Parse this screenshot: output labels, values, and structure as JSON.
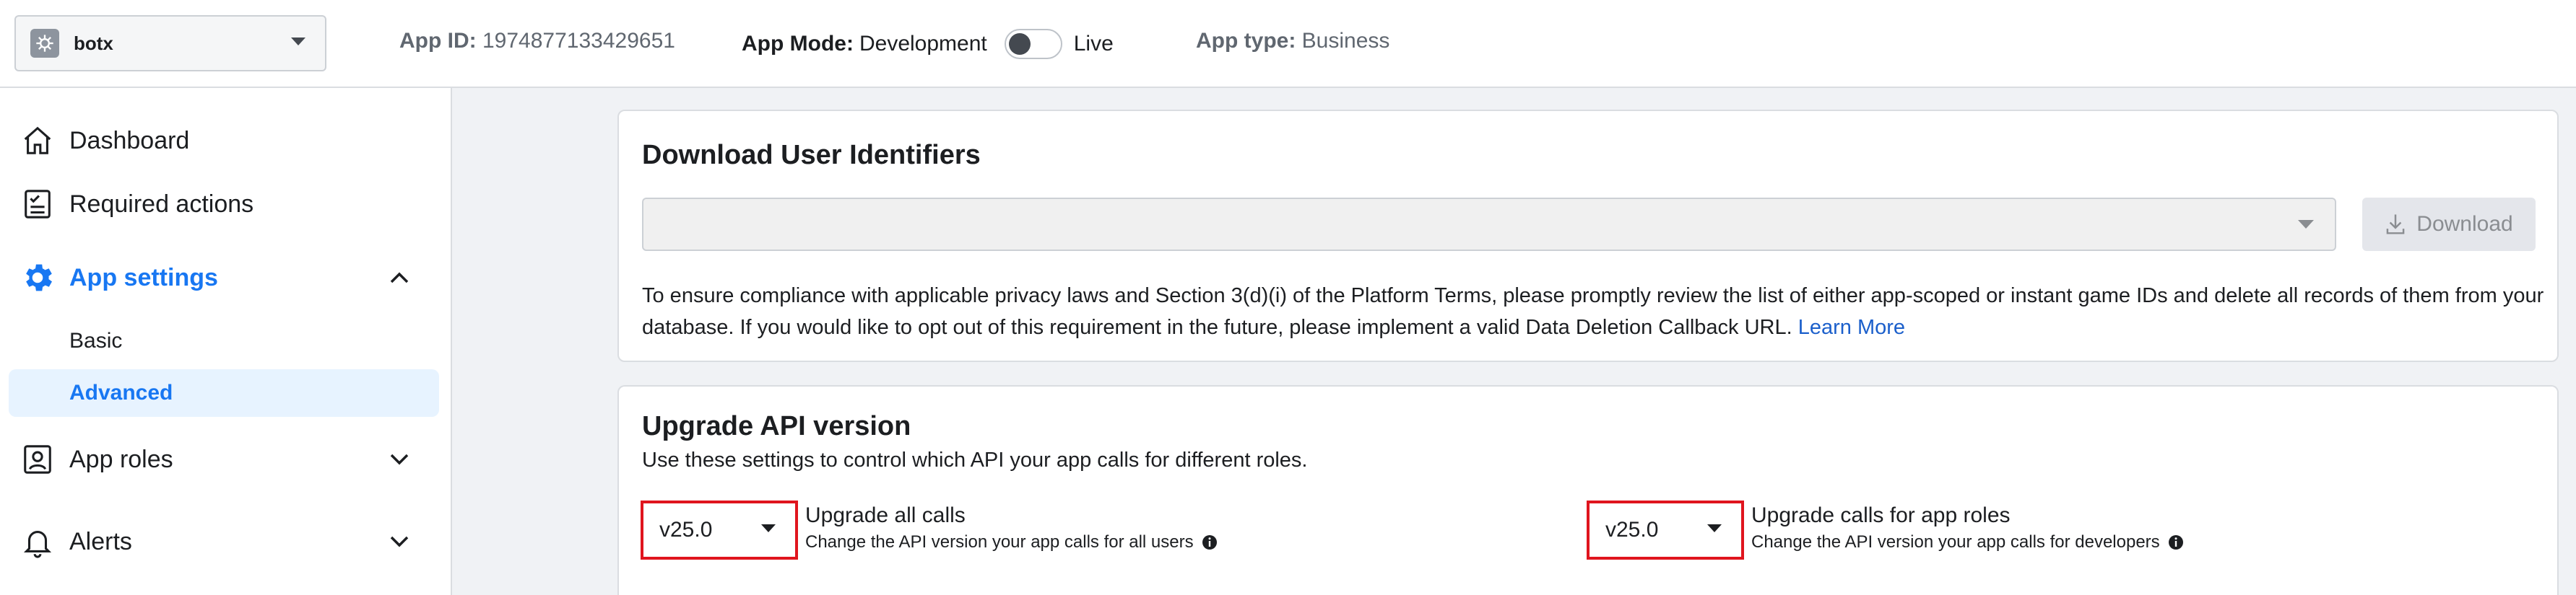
{
  "topbar": {
    "app_name": "botx",
    "app_id_label": "App ID:",
    "app_id_value": "1974877133429651",
    "app_mode_label": "App Mode:",
    "app_mode_dev": "Development",
    "app_mode_live": "Live",
    "app_type_label": "App type:",
    "app_type_value": "Business"
  },
  "sidebar": {
    "items": [
      {
        "label": "Dashboard",
        "icon": "home-icon"
      },
      {
        "label": "Required actions",
        "icon": "checklist-icon"
      },
      {
        "label": "App settings",
        "icon": "gear-icon",
        "expanded": true
      },
      {
        "label": "App roles",
        "icon": "user-badge-icon"
      },
      {
        "label": "Alerts",
        "icon": "bell-icon"
      }
    ],
    "sub_items": [
      {
        "label": "Basic"
      },
      {
        "label": "Advanced",
        "selected": true
      }
    ]
  },
  "download_panel": {
    "title": "Download User Identifiers",
    "button_label": "Download",
    "text": "To ensure compliance with applicable privacy laws and Section 3(d)(i) of the Platform Terms, please promptly review the list of either app-scoped or instant game IDs and delete all records of them from your database. If you would like to opt out of this requirement in the future, please implement a valid Data Deletion Callback URL.",
    "link": "Learn More"
  },
  "upgrade_panel": {
    "title": "Upgrade API version",
    "subtitle": "Use these settings to control which API your app calls for different roles.",
    "all_calls": {
      "version": "v25.0",
      "label": "Upgrade all calls",
      "desc": "Change the API version your app calls for all users"
    },
    "app_roles": {
      "version": "v25.0",
      "label": "Upgrade calls for app roles",
      "desc": "Change the API version your app calls for developers"
    }
  },
  "colors": {
    "accent": "#1877f2",
    "highlight_border": "#e0151e",
    "selected_bg": "#e7f3ff"
  }
}
